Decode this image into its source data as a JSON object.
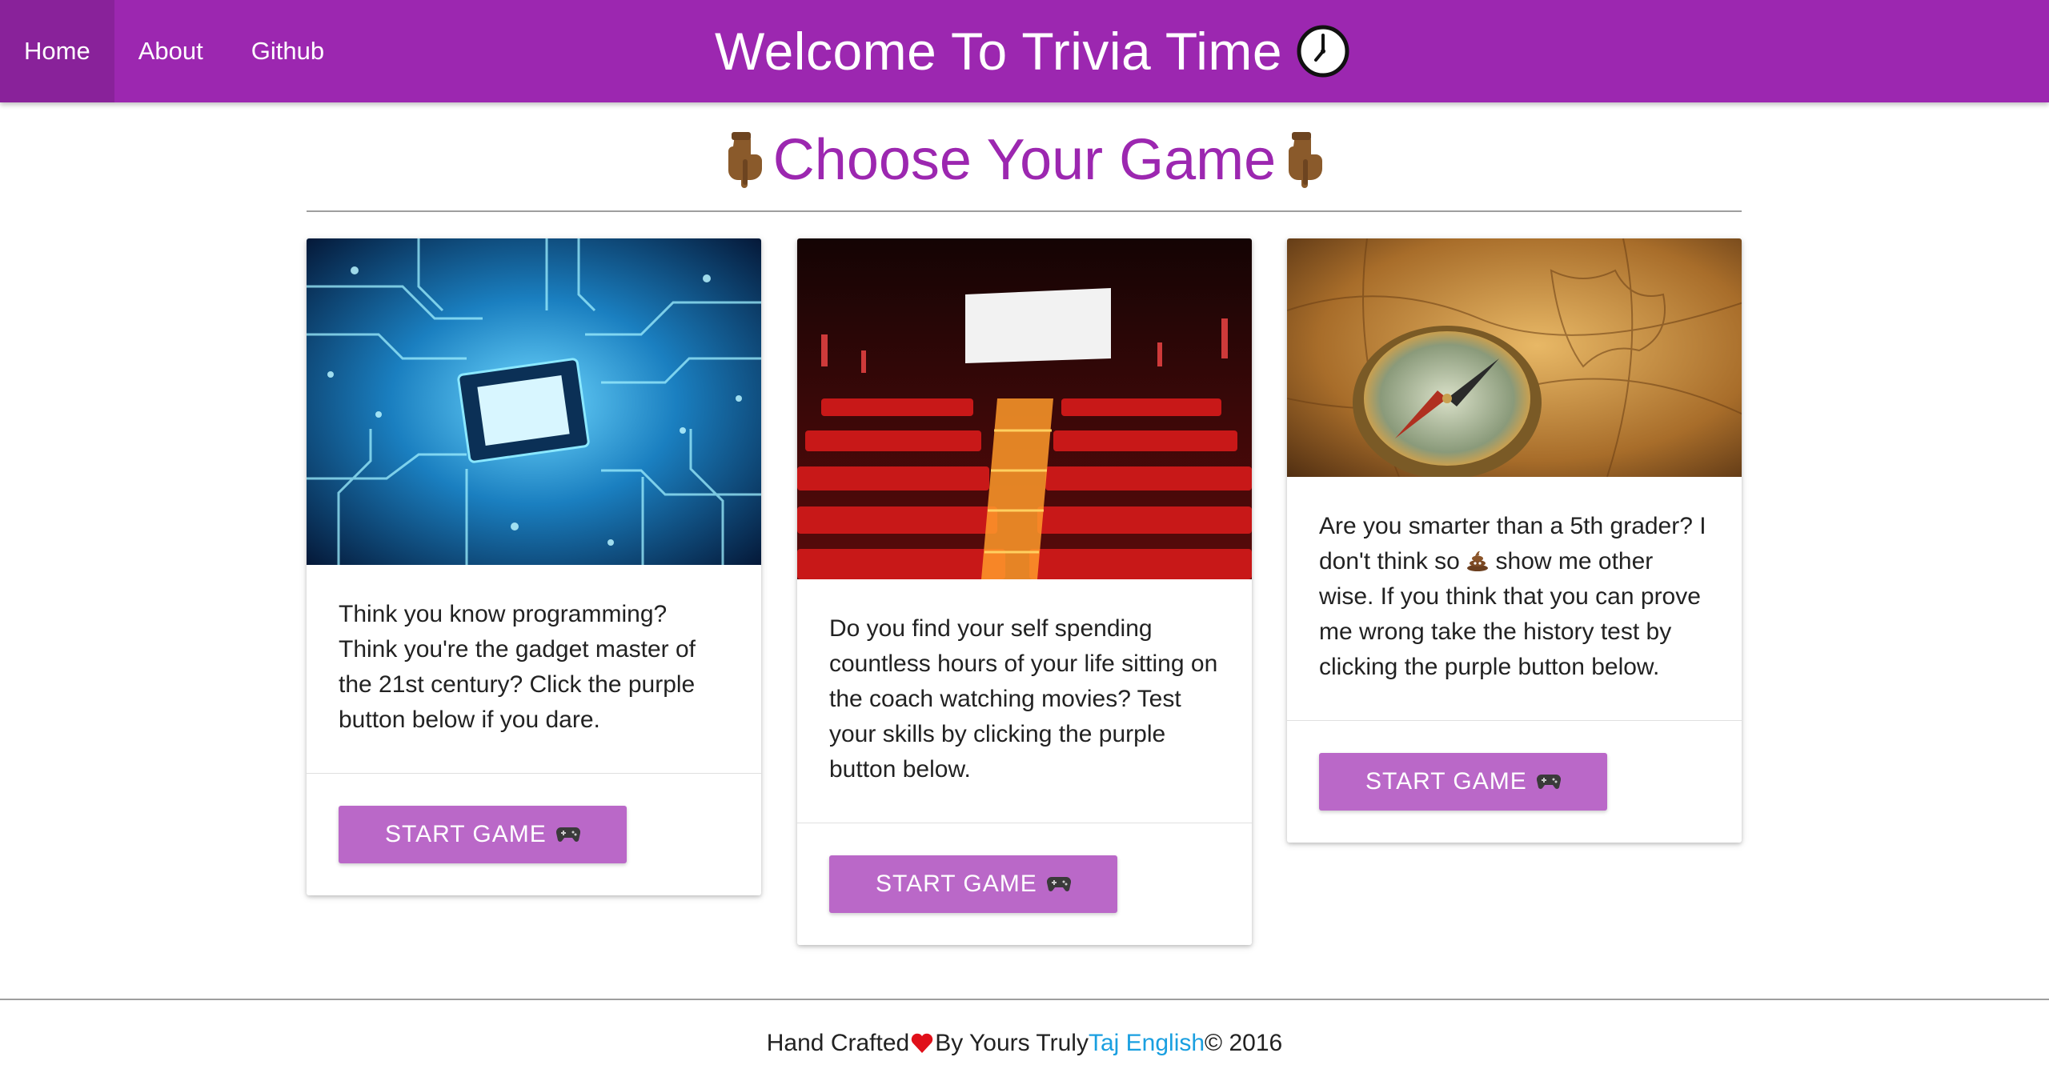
{
  "nav": {
    "items": [
      {
        "label": "Home",
        "active": true
      },
      {
        "label": "About",
        "active": false
      },
      {
        "label": "Github",
        "active": false
      }
    ],
    "brand": "Welcome To Trivia Time",
    "brand_icon": "clock-icon"
  },
  "heading": {
    "text": "Choose Your Game",
    "icon": "pointing-down-icon"
  },
  "cards": [
    {
      "image": "circuit-board-image",
      "text": "Think you know programming? Think you're the gadget master of the 21st century? Click the purple button below if you dare.",
      "button": "START GAME"
    },
    {
      "image": "movie-theater-image",
      "text": "Do you find your self spending countless hours of your life sitting on the coach watching movies? Test your skills by clicking the purple button below.",
      "button": "START GAME"
    },
    {
      "image": "compass-map-image",
      "text_before": "Are you smarter than a 5th grader? I don't think so",
      "text_after": "show me other wise. If you think that you can prove me wrong take the history test by clicking the purple button below.",
      "button": "START GAME"
    }
  ],
  "footer": {
    "prefix": "Hand Crafted",
    "middle": "By Yours Truly",
    "author": "Taj English",
    "suffix": "© 2016"
  },
  "colors": {
    "primary": "#9c27b0",
    "button": "#ba68c8",
    "link": "#1a9fe0",
    "heart": "#e0101a"
  }
}
